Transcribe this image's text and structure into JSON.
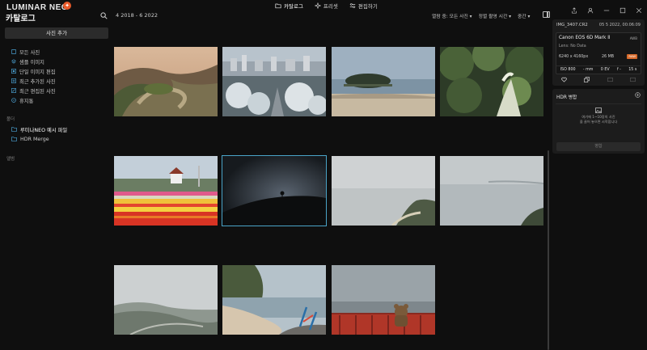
{
  "app": {
    "brand": "LUMINAR NEO",
    "brand_badge": "✦",
    "page_title": "카탈로그"
  },
  "top_tabs": [
    {
      "label": "카탈로그",
      "icon": "folder-icon",
      "active": true
    },
    {
      "label": "프리셋",
      "icon": "sparkle-icon",
      "active": false
    },
    {
      "label": "편집하기",
      "icon": "sliders-icon",
      "active": false
    }
  ],
  "date_range": "4 2018 - 6 2022",
  "sort_bar": {
    "filter": "열람 중: 모든 사진",
    "sort": "정렬 촬영 시간",
    "size": "중간"
  },
  "sidebar": {
    "add_photo_label": "사진 추가",
    "nav_items": [
      {
        "label": "모든 사진",
        "icon": "photos-icon"
      },
      {
        "label": "샘플 이미지",
        "icon": "layers-icon"
      },
      {
        "label": "단일 이미지 편집",
        "icon": "image-edit-icon"
      },
      {
        "label": "최근 추가된 사진",
        "icon": "recent-add-icon"
      },
      {
        "label": "최근 편집된 사진",
        "icon": "recent-edit-icon"
      },
      {
        "label": "휴지통",
        "icon": "trash-icon"
      }
    ],
    "folders_label": "폴더",
    "folders": [
      {
        "label": "루미나NEO 예시 파일",
        "active": true
      },
      {
        "label": "HDR Merge",
        "active": false
      }
    ],
    "albums_label": "앨범"
  },
  "info": {
    "file_name": "IMG_3407.CR2",
    "file_date": "05 5 2022, 00:06:09",
    "camera": "Canon EOS 6D Mark II",
    "awb": "AWB",
    "lens": "Lens: No Data",
    "dimensions": "6240 x 4160px",
    "file_size": "26 MB",
    "raw_badge": "RAW",
    "iso": "ISO 800",
    "focal": "- mm",
    "ev": "0 EV",
    "aperture": "f -",
    "shutter": "15 s"
  },
  "hdr": {
    "title": "HDR 병합",
    "drop_line1": "여기에 1~10장의 사진",
    "drop_line2": "을 끌어 놓으면 시작합니다",
    "merge_label": "병합"
  },
  "gallery": [
    {
      "name": "river-bend"
    },
    {
      "name": "snowy-town"
    },
    {
      "name": "island-beach"
    },
    {
      "name": "forest-path"
    },
    {
      "name": "tulip-field"
    },
    {
      "name": "night-hill"
    },
    {
      "name": "hazy-sea-1"
    },
    {
      "name": "hazy-sea-2"
    },
    {
      "name": "foggy-coast"
    },
    {
      "name": "rocky-beach"
    },
    {
      "name": "teddy-bear-view"
    }
  ]
}
